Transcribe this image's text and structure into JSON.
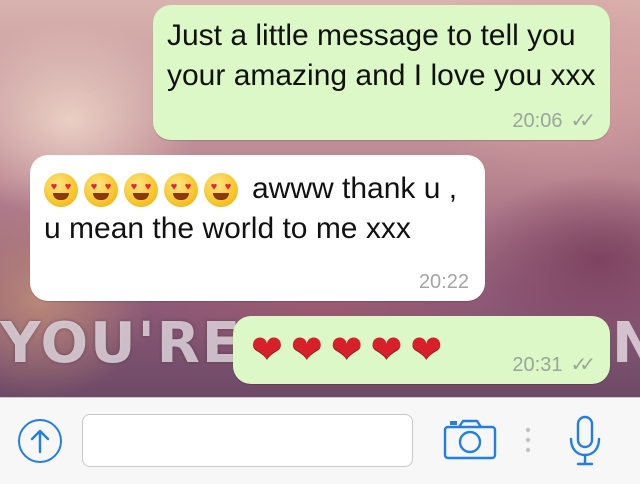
{
  "conversation": {
    "messages": [
      {
        "direction": "outgoing",
        "text": "Just a little message to tell you your amazing and I love you xxx",
        "time": "20:06",
        "status": "read-double-check-icon"
      },
      {
        "direction": "incoming",
        "emoji": [
          "heart-eyes-emoji",
          "heart-eyes-emoji",
          "heart-eyes-emoji",
          "heart-eyes-emoji",
          "heart-eyes-emoji"
        ],
        "text": "awww thank u , u mean the world to me xxx",
        "time": "20:22"
      },
      {
        "direction": "outgoing",
        "emoji": [
          "red-heart-emoji",
          "red-heart-emoji",
          "red-heart-emoji",
          "red-heart-emoji",
          "red-heart-emoji"
        ],
        "time": "20:31",
        "status": "read-double-check-icon"
      }
    ]
  },
  "wallpaper": {
    "text": "YOU'RE",
    "trailing_text": "N"
  },
  "toolbar": {
    "message_value": "",
    "icons": {
      "attach": "upload-arrow-icon",
      "camera": "camera-icon",
      "divider": "dots-divider-icon",
      "mic": "microphone-icon"
    }
  },
  "colors": {
    "outgoing_bubble": "#dcf8c6",
    "incoming_bubble": "#ffffff",
    "accent_blue": "#1f7ee8",
    "emoji_heart": "#d8202a"
  }
}
